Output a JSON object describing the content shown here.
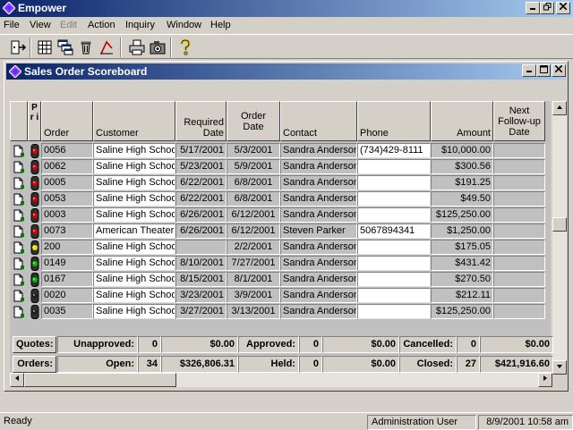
{
  "app": {
    "title": "Empower"
  },
  "menu": [
    {
      "label": "File",
      "enabled": true
    },
    {
      "label": "View",
      "enabled": true
    },
    {
      "label": "Edit",
      "enabled": false
    },
    {
      "label": "Action",
      "enabled": true
    },
    {
      "label": "Inquiry",
      "enabled": true
    },
    {
      "label": "Window",
      "enabled": true
    },
    {
      "label": "Help",
      "enabled": true
    }
  ],
  "toolbar": [
    "exit-icon",
    "grid-icon",
    "cascade-icon",
    "delete-icon",
    "sort-icon",
    "print-icon",
    "camera-icon",
    "help-icon"
  ],
  "child": {
    "title": "Sales Order Scoreboard"
  },
  "columns": {
    "pri": "P r i",
    "order": "Order",
    "customer": "Customer",
    "required": "Required Date",
    "orderdate": "Order Date",
    "contact": "Contact",
    "phone": "Phone",
    "amount": "Amount",
    "followup": "Next Follow-up Date"
  },
  "rows": [
    {
      "status": "red",
      "order": "0056",
      "customer": "Saline High School",
      "required": "5/17/2001",
      "orderdate": "5/3/2001",
      "contact": "Sandra Anderson",
      "phone": "(734)429-8111",
      "amount": "$10,000.00"
    },
    {
      "status": "red",
      "order": "0062",
      "customer": "Saline High School",
      "required": "5/23/2001",
      "orderdate": "5/9/2001",
      "contact": "Sandra Anderson",
      "phone": "",
      "amount": "$300.56"
    },
    {
      "status": "red",
      "order": "0005",
      "customer": "Saline High School",
      "required": "6/22/2001",
      "orderdate": "6/8/2001",
      "contact": "Sandra Anderson",
      "phone": "",
      "amount": "$191.25"
    },
    {
      "status": "red",
      "order": "0053",
      "customer": "Saline High School",
      "required": "6/22/2001",
      "orderdate": "6/8/2001",
      "contact": "Sandra Anderson",
      "phone": "",
      "amount": "$49.50"
    },
    {
      "status": "red",
      "order": "0003",
      "customer": "Saline High School",
      "required": "6/26/2001",
      "orderdate": "6/12/2001",
      "contact": "Sandra Anderson",
      "phone": "",
      "amount": "$125,250.00"
    },
    {
      "status": "red",
      "order": "0073",
      "customer": "American Theater",
      "required": "6/26/2001",
      "orderdate": "6/12/2001",
      "contact": "Steven Parker",
      "phone": "5067894341",
      "amount": "$1,250.00"
    },
    {
      "status": "yellow",
      "order": "200",
      "customer": "Saline High School",
      "required": "",
      "orderdate": "2/2/2001",
      "contact": "Sandra Anderson",
      "phone": "",
      "amount": "$175.05"
    },
    {
      "status": "green",
      "order": "0149",
      "customer": "Saline High School",
      "required": "8/10/2001",
      "orderdate": "7/27/2001",
      "contact": "Sandra Anderson",
      "phone": "",
      "amount": "$431.42"
    },
    {
      "status": "green",
      "order": "0167",
      "customer": "Saline High School",
      "required": "8/15/2001",
      "orderdate": "8/1/2001",
      "contact": "Sandra Anderson",
      "phone": "",
      "amount": "$270.50"
    },
    {
      "status": "black",
      "order": "0020",
      "customer": "Saline High School",
      "required": "3/23/2001",
      "orderdate": "3/9/2001",
      "contact": "Sandra Anderson",
      "phone": "",
      "amount": "$212.11"
    },
    {
      "status": "black",
      "order": "0035",
      "customer": "Saline High School",
      "required": "3/27/2001",
      "orderdate": "3/13/2001",
      "contact": "Sandra Anderson",
      "phone": "",
      "amount": "$125,250.00"
    }
  ],
  "quotes": {
    "label": "Quotes:",
    "unapproved_label": "Unapproved:",
    "unapproved_count": "0",
    "unapproved_amount": "$0.00",
    "approved_label": "Approved:",
    "approved_count": "0",
    "approved_amount": "$0.00",
    "cancelled_label": "Cancelled:",
    "cancelled_count": "0",
    "cancelled_amount": "$0.00"
  },
  "orders": {
    "label": "Orders:",
    "open_label": "Open:",
    "open_count": "34",
    "open_amount": "$326,806.31",
    "held_label": "Held:",
    "held_count": "0",
    "held_amount": "$0.00",
    "closed_label": "Closed:",
    "closed_count": "27",
    "closed_amount": "$421,916.60"
  },
  "status": {
    "ready": "Ready",
    "user": "Administration User",
    "datetime": "8/9/2001 10:58 am"
  },
  "colors": {
    "red": "#e00000",
    "yellow": "#f0e000",
    "green": "#00c000",
    "black": "#202020",
    "title": "#0a246a"
  }
}
